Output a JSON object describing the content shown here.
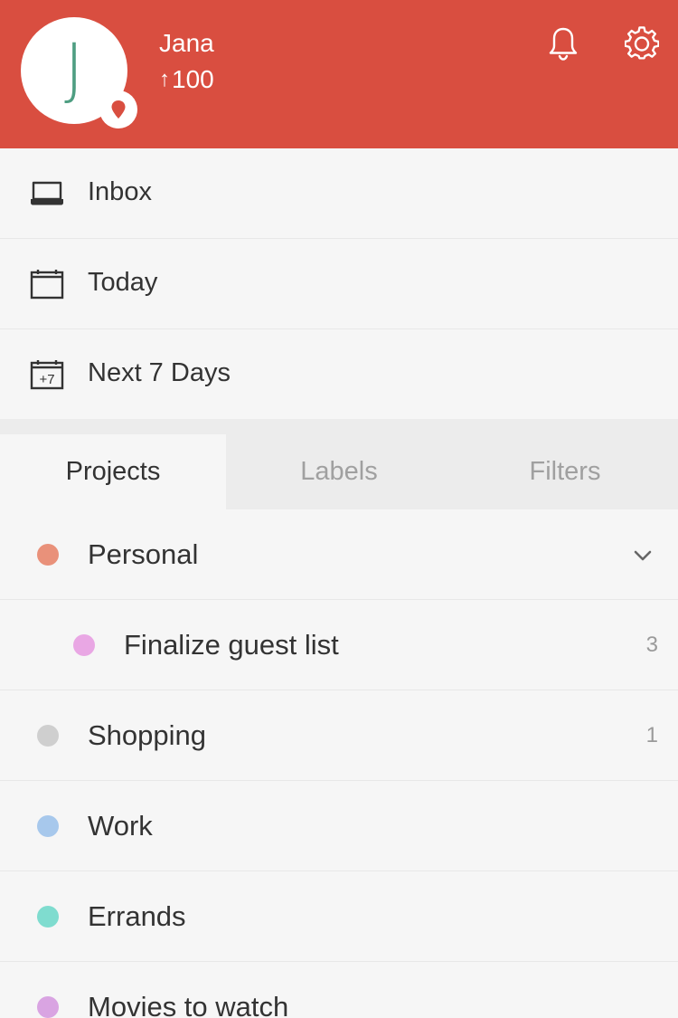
{
  "header": {
    "avatar_letter": "J",
    "user_name": "Jana",
    "karma_arrow": "↑",
    "karma_value": "100",
    "bg_color": "#d94e40",
    "icons": [
      "location-pin-icon",
      "bell-icon",
      "gear-icon"
    ]
  },
  "nav": [
    {
      "label": "Inbox",
      "icon": "inbox-icon"
    },
    {
      "label": "Today",
      "icon": "calendar-icon"
    },
    {
      "label": "Next 7 Days",
      "icon": "calendar-plus7-icon",
      "icon_text": "+7"
    }
  ],
  "tabs": [
    {
      "label": "Projects",
      "active": true
    },
    {
      "label": "Labels",
      "active": false
    },
    {
      "label": "Filters",
      "active": false
    }
  ],
  "projects": [
    {
      "label": "Personal",
      "color": "#e9917a",
      "count": "",
      "expandable": true,
      "indent": 0
    },
    {
      "label": "Finalize guest list",
      "color": "#e9a7e4",
      "count": "3",
      "expandable": false,
      "indent": 1
    },
    {
      "label": "Shopping",
      "color": "#cfcfcf",
      "count": "1",
      "expandable": false,
      "indent": 0
    },
    {
      "label": "Work",
      "color": "#a7c8ec",
      "count": "",
      "expandable": false,
      "indent": 0
    },
    {
      "label": "Errands",
      "color": "#7fdccf",
      "count": "",
      "expandable": false,
      "indent": 0
    },
    {
      "label": "Movies to watch",
      "color": "#d9a4e2",
      "count": "",
      "expandable": false,
      "indent": 0
    }
  ]
}
